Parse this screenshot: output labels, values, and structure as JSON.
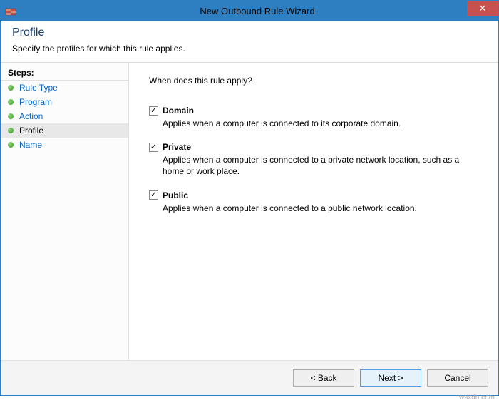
{
  "window": {
    "title": "New Outbound Rule Wizard",
    "close_glyph": "✕"
  },
  "header": {
    "title": "Profile",
    "subtitle": "Specify the profiles for which this rule applies."
  },
  "sidebar": {
    "header": "Steps:",
    "items": [
      {
        "label": "Rule Type",
        "current": false
      },
      {
        "label": "Program",
        "current": false
      },
      {
        "label": "Action",
        "current": false
      },
      {
        "label": "Profile",
        "current": true
      },
      {
        "label": "Name",
        "current": false
      }
    ]
  },
  "content": {
    "question": "When does this rule apply?",
    "options": [
      {
        "label": "Domain",
        "checked": true,
        "desc": "Applies when a computer is connected to its corporate domain."
      },
      {
        "label": "Private",
        "checked": true,
        "desc": "Applies when a computer is connected to a private network location, such as a home or work place."
      },
      {
        "label": "Public",
        "checked": true,
        "desc": "Applies when a computer is connected to a public network location."
      }
    ]
  },
  "buttons": {
    "back": "< Back",
    "next": "Next >",
    "cancel": "Cancel"
  },
  "watermark": "wsxdn.com"
}
